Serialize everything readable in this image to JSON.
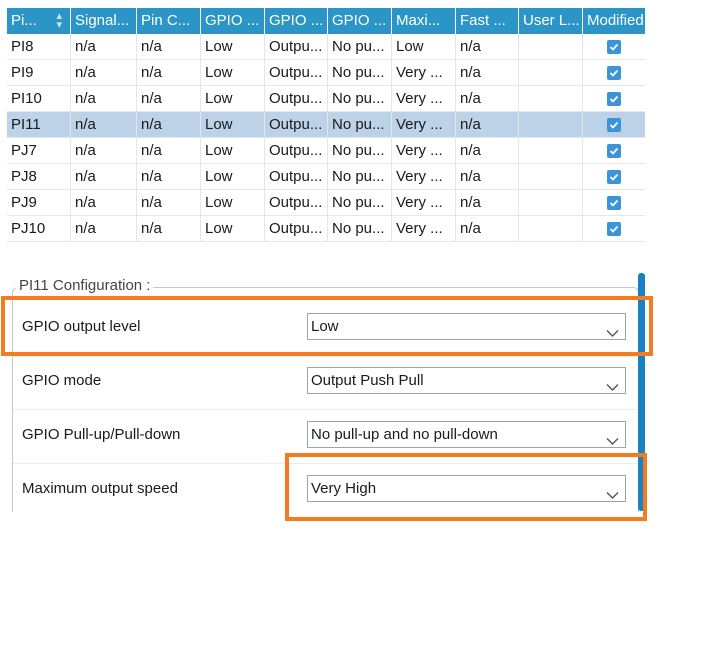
{
  "table": {
    "columns": [
      "Pi...",
      "Signal...",
      "Pin C...",
      "GPIO ...",
      "GPIO ...",
      "GPIO ...",
      "Maxi...",
      "Fast ...",
      "User L...",
      "Modified"
    ],
    "sort_column_index": 0,
    "rows": [
      {
        "cells": [
          "PI8",
          "n/a",
          "n/a",
          "Low",
          "Outpu...",
          "No pu...",
          "Low",
          "n/a",
          ""
        ],
        "modified": true,
        "selected": false
      },
      {
        "cells": [
          "PI9",
          "n/a",
          "n/a",
          "Low",
          "Outpu...",
          "No pu...",
          "Very ...",
          "n/a",
          ""
        ],
        "modified": true,
        "selected": false
      },
      {
        "cells": [
          "PI10",
          "n/a",
          "n/a",
          "Low",
          "Outpu...",
          "No pu...",
          "Very ...",
          "n/a",
          ""
        ],
        "modified": true,
        "selected": false
      },
      {
        "cells": [
          "PI11",
          "n/a",
          "n/a",
          "Low",
          "Outpu...",
          "No pu...",
          "Very ...",
          "n/a",
          ""
        ],
        "modified": true,
        "selected": true
      },
      {
        "cells": [
          "PJ7",
          "n/a",
          "n/a",
          "Low",
          "Outpu...",
          "No pu...",
          "Very ...",
          "n/a",
          ""
        ],
        "modified": true,
        "selected": false
      },
      {
        "cells": [
          "PJ8",
          "n/a",
          "n/a",
          "Low",
          "Outpu...",
          "No pu...",
          "Very ...",
          "n/a",
          ""
        ],
        "modified": true,
        "selected": false
      },
      {
        "cells": [
          "PJ9",
          "n/a",
          "n/a",
          "Low",
          "Outpu...",
          "No pu...",
          "Very ...",
          "n/a",
          ""
        ],
        "modified": true,
        "selected": false
      },
      {
        "cells": [
          "PJ10",
          "n/a",
          "n/a",
          "Low",
          "Outpu...",
          "No pu...",
          "Very ...",
          "n/a",
          ""
        ],
        "modified": true,
        "selected": false
      }
    ]
  },
  "config": {
    "title": "PI11 Configuration :",
    "fields": [
      {
        "label": "GPIO output level",
        "value": "Low",
        "highlighted": true
      },
      {
        "label": "GPIO mode",
        "value": "Output Push Pull",
        "highlighted": false
      },
      {
        "label": "GPIO Pull-up/Pull-down",
        "value": "No pull-up and no pull-down",
        "highlighted": false
      },
      {
        "label": "Maximum output speed",
        "value": "Very High",
        "highlighted": true
      }
    ]
  },
  "colors": {
    "header_bg": "#2b95c8",
    "selected_row": "#bcd2e8",
    "checkbox": "#3b94d9",
    "highlight": "#f47b20"
  },
  "icons": {
    "sort": "sort-updown-icon",
    "dropdown": "chevron-down-icon",
    "checked": "checkbox-checked-icon"
  }
}
